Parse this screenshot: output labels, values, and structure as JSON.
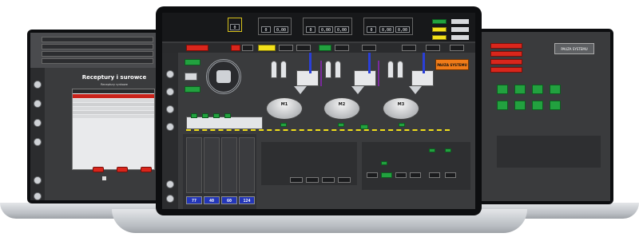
{
  "left_screen": {
    "title": "Receptury i surowce",
    "subtitle": "Receptury rynkowe",
    "menu_rows": [
      {
        "code": "Dodatek"
      },
      {
        "code": "Receptura"
      },
      {
        "code": "Receptura"
      },
      {
        "code": "Receptura"
      }
    ],
    "dialog_buttons": [
      "",
      "",
      ""
    ]
  },
  "center_screen": {
    "header": {
      "status_lines": [
        "",
        ""
      ],
      "counter_1": "0",
      "groups": [
        {
          "a": "0",
          "b": "0,00"
        },
        {
          "a": "0",
          "b": "0,00",
          "c": "0,00"
        },
        {
          "a": "0",
          "b": "0,00",
          "c": "0,00"
        },
        {
          "a": "0",
          "b": "0"
        }
      ]
    },
    "alarm_label": "PAUZA SYSTEMU",
    "mixers": [
      "M1",
      "M2",
      "M3"
    ],
    "bottom_values": [
      "77",
      "40",
      "60",
      "124"
    ]
  },
  "right_screen": {
    "system_label": "PAUZA SYSTEMU",
    "counters": [
      "0",
      "0",
      "0",
      "0"
    ]
  },
  "colors": {
    "green": "#22a13f",
    "red": "#d9261c",
    "yellow": "#f2e01b",
    "orange": "#f07b18",
    "blue": "#2336b8",
    "panel": "#3a3b3d"
  }
}
